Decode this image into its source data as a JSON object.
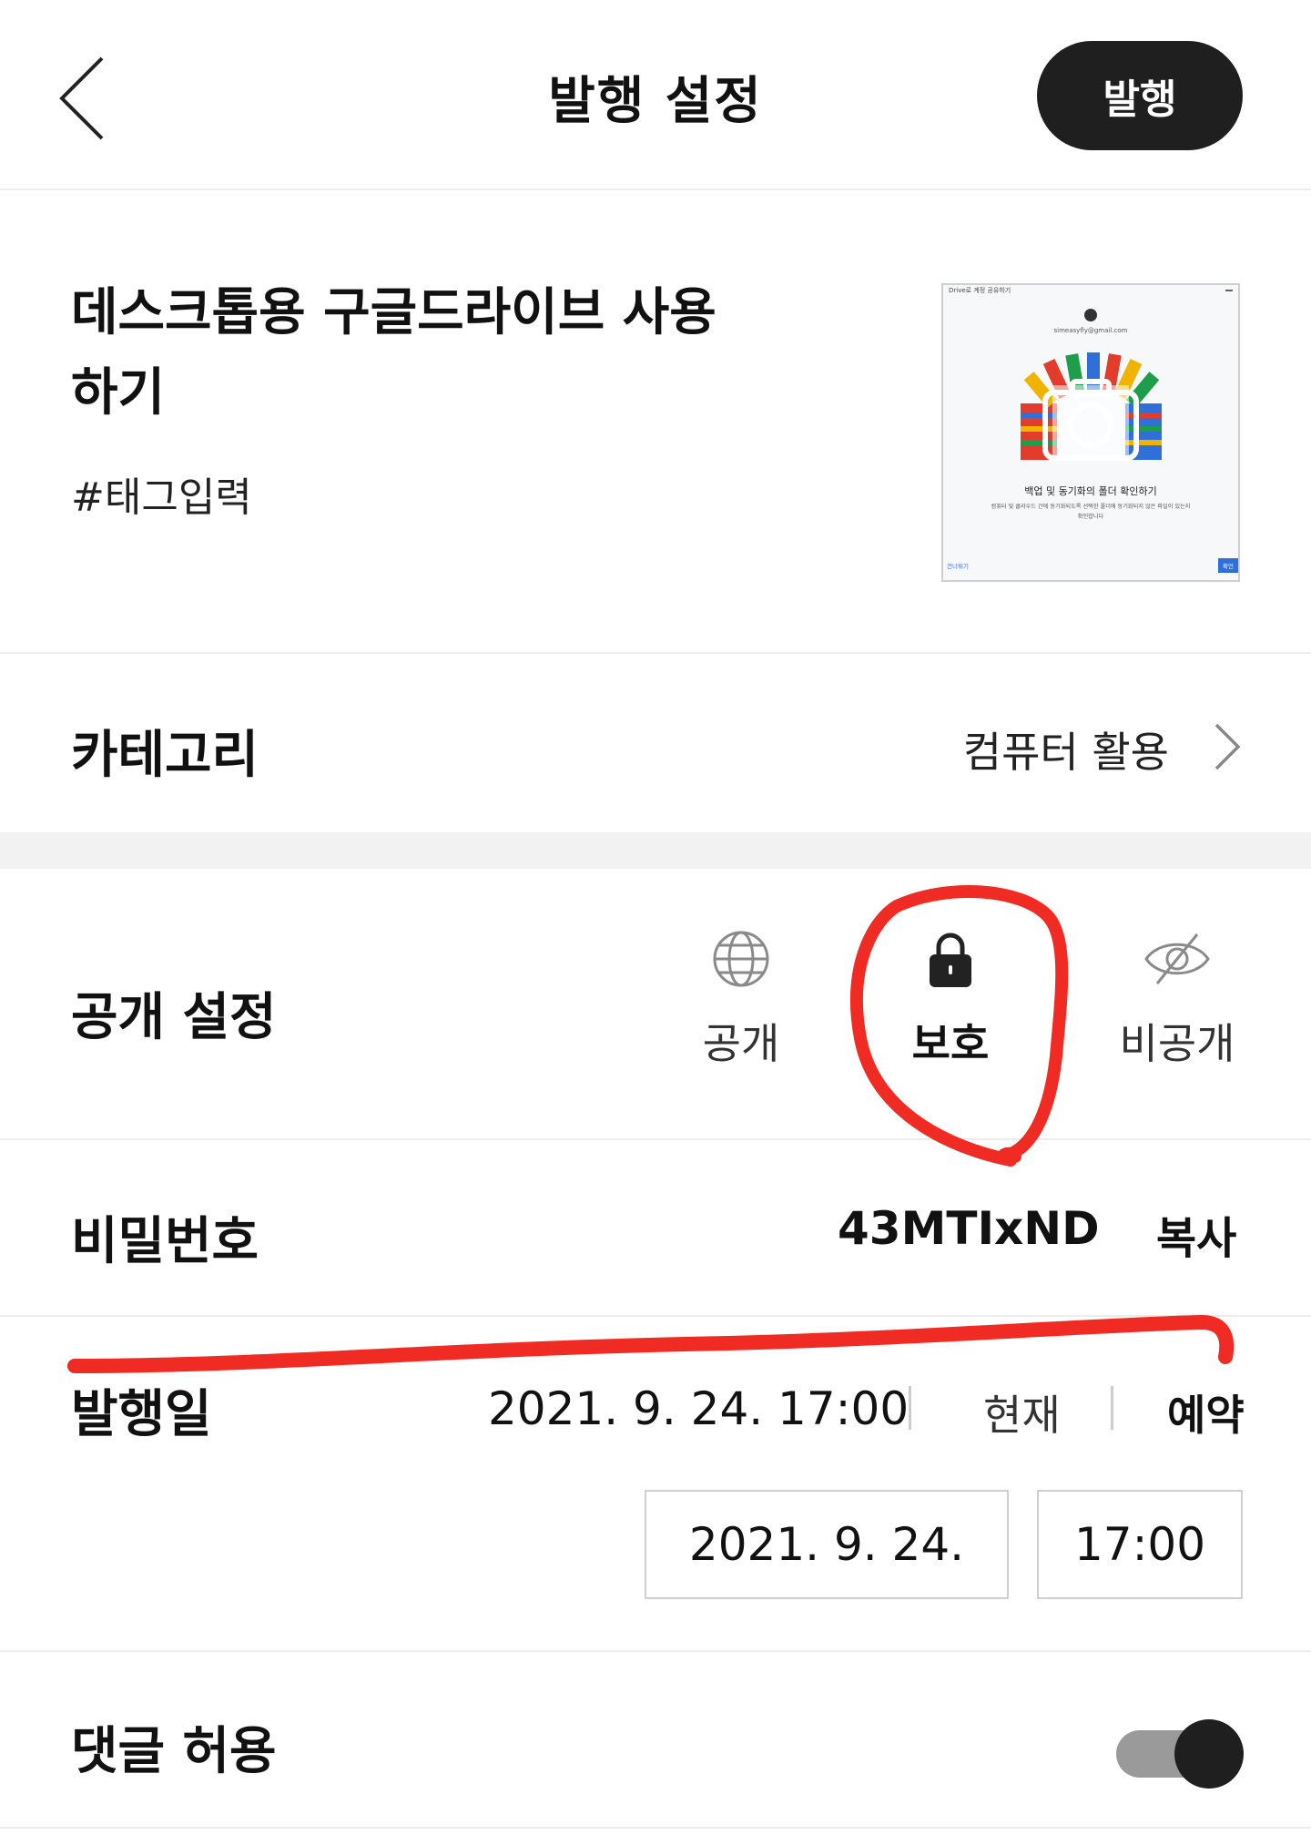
{
  "header": {
    "title": "발행 설정",
    "publish_label": "발행"
  },
  "post": {
    "title": "데스크톱용 구글드라이브 사용하기",
    "tags": "#태그입력",
    "thumbnail": {
      "window_title": "Drive로 계정 공유하기",
      "email": "simeasyfly@gmail.com",
      "caption": "백업 및 동기화의 폴더 확인하기",
      "desc_line1": "컴퓨터 및 클라우드 간에 동기화되도록 선택한 폴더에 동기화되지 않은 파일이 있는지",
      "desc_line2": "확인합니다",
      "link": "건너뛰기",
      "button": "확인"
    }
  },
  "category": {
    "label": "카테고리",
    "value": "컴퓨터 활용"
  },
  "visibility": {
    "label": "공개 설정",
    "options": [
      {
        "label": "공개",
        "icon": "globe-icon"
      },
      {
        "label": "보호",
        "icon": "lock-icon"
      },
      {
        "label": "비공개",
        "icon": "eye-off-icon"
      }
    ],
    "selected": "보호"
  },
  "password": {
    "label": "비밀번호",
    "value": "43MTIxND",
    "copy_label": "복사"
  },
  "publish_date": {
    "label": "발행일",
    "value": "2021. 9. 24. 17:00",
    "now_label": "현재",
    "schedule_label": "예약",
    "date_input": "2021. 9. 24.",
    "time_input": "17:00"
  },
  "comments": {
    "label": "댓글 허용",
    "enabled": true
  },
  "colors": {
    "accent_dark": "#1f1f1f",
    "annotation_red": "#ef2b24",
    "divider": "#ececec"
  }
}
